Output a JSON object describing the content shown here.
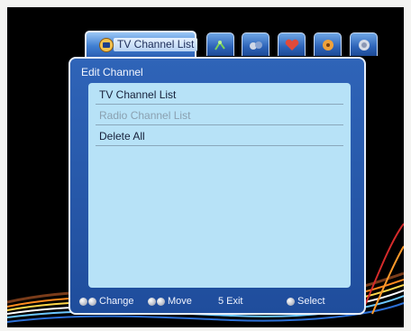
{
  "tabs": [
    {
      "label": "TV Channel List",
      "icon": "tv-icon",
      "active": true
    },
    {
      "label": "",
      "icon": "satellite-dish-icon",
      "active": false
    },
    {
      "label": "",
      "icon": "tools-icon",
      "active": false
    },
    {
      "label": "",
      "icon": "heart-icon",
      "active": false
    },
    {
      "label": "",
      "icon": "settings-icon",
      "active": false
    },
    {
      "label": "",
      "icon": "info-icon",
      "active": false
    }
  ],
  "panel": {
    "title": "Edit Channel"
  },
  "list": [
    {
      "label": "TV Channel List",
      "enabled": true
    },
    {
      "label": "Radio Channel List",
      "enabled": false
    },
    {
      "label": "Delete All",
      "enabled": true
    }
  ],
  "footer": {
    "change": "Change",
    "move": "Move",
    "exit_key": "5",
    "exit": "Exit",
    "select": "Select"
  },
  "colors": {
    "panel": "#2f64b8",
    "list_bg": "#b7e2f7",
    "accent": "#e6eefb"
  }
}
